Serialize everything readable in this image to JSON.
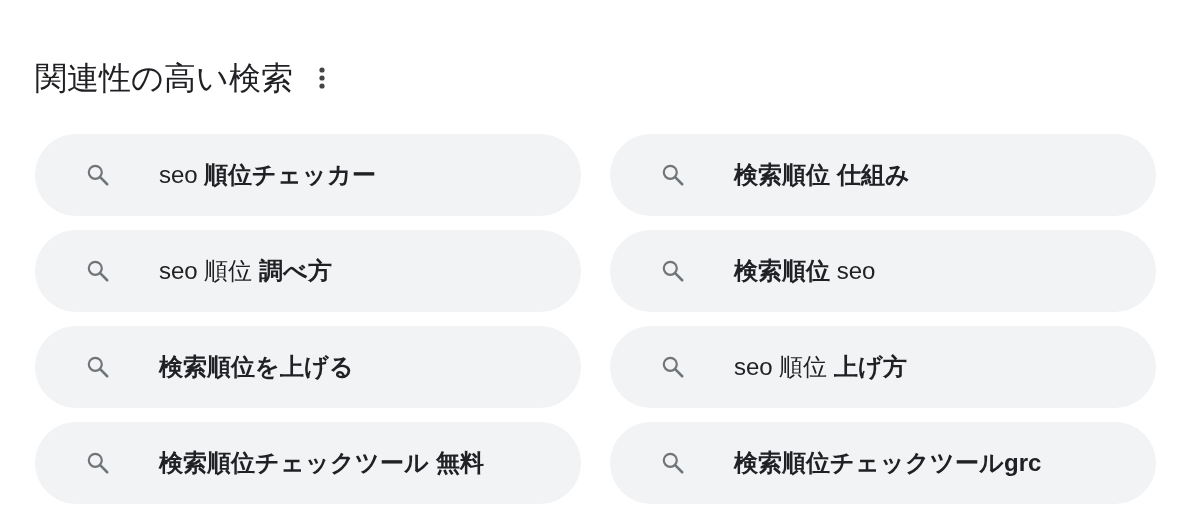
{
  "heading": "関連性の高い検索",
  "suggestions": [
    {
      "text": "seo **順位チェッカー**",
      "bold": false
    },
    {
      "text": "検索順位 仕組み",
      "bold": true
    },
    {
      "text": "seo 順位 **調べ方**",
      "bold": false
    },
    {
      "text": "**検索順位** seo",
      "bold": false
    },
    {
      "text": "検索順位を上げる",
      "bold": true
    },
    {
      "text": "seo 順位 **上げ方**",
      "bold": false
    },
    {
      "text": "検索順位チェックツール 無料",
      "bold": true
    },
    {
      "text": "検索順位チェックツールgrc",
      "bold": true
    }
  ]
}
